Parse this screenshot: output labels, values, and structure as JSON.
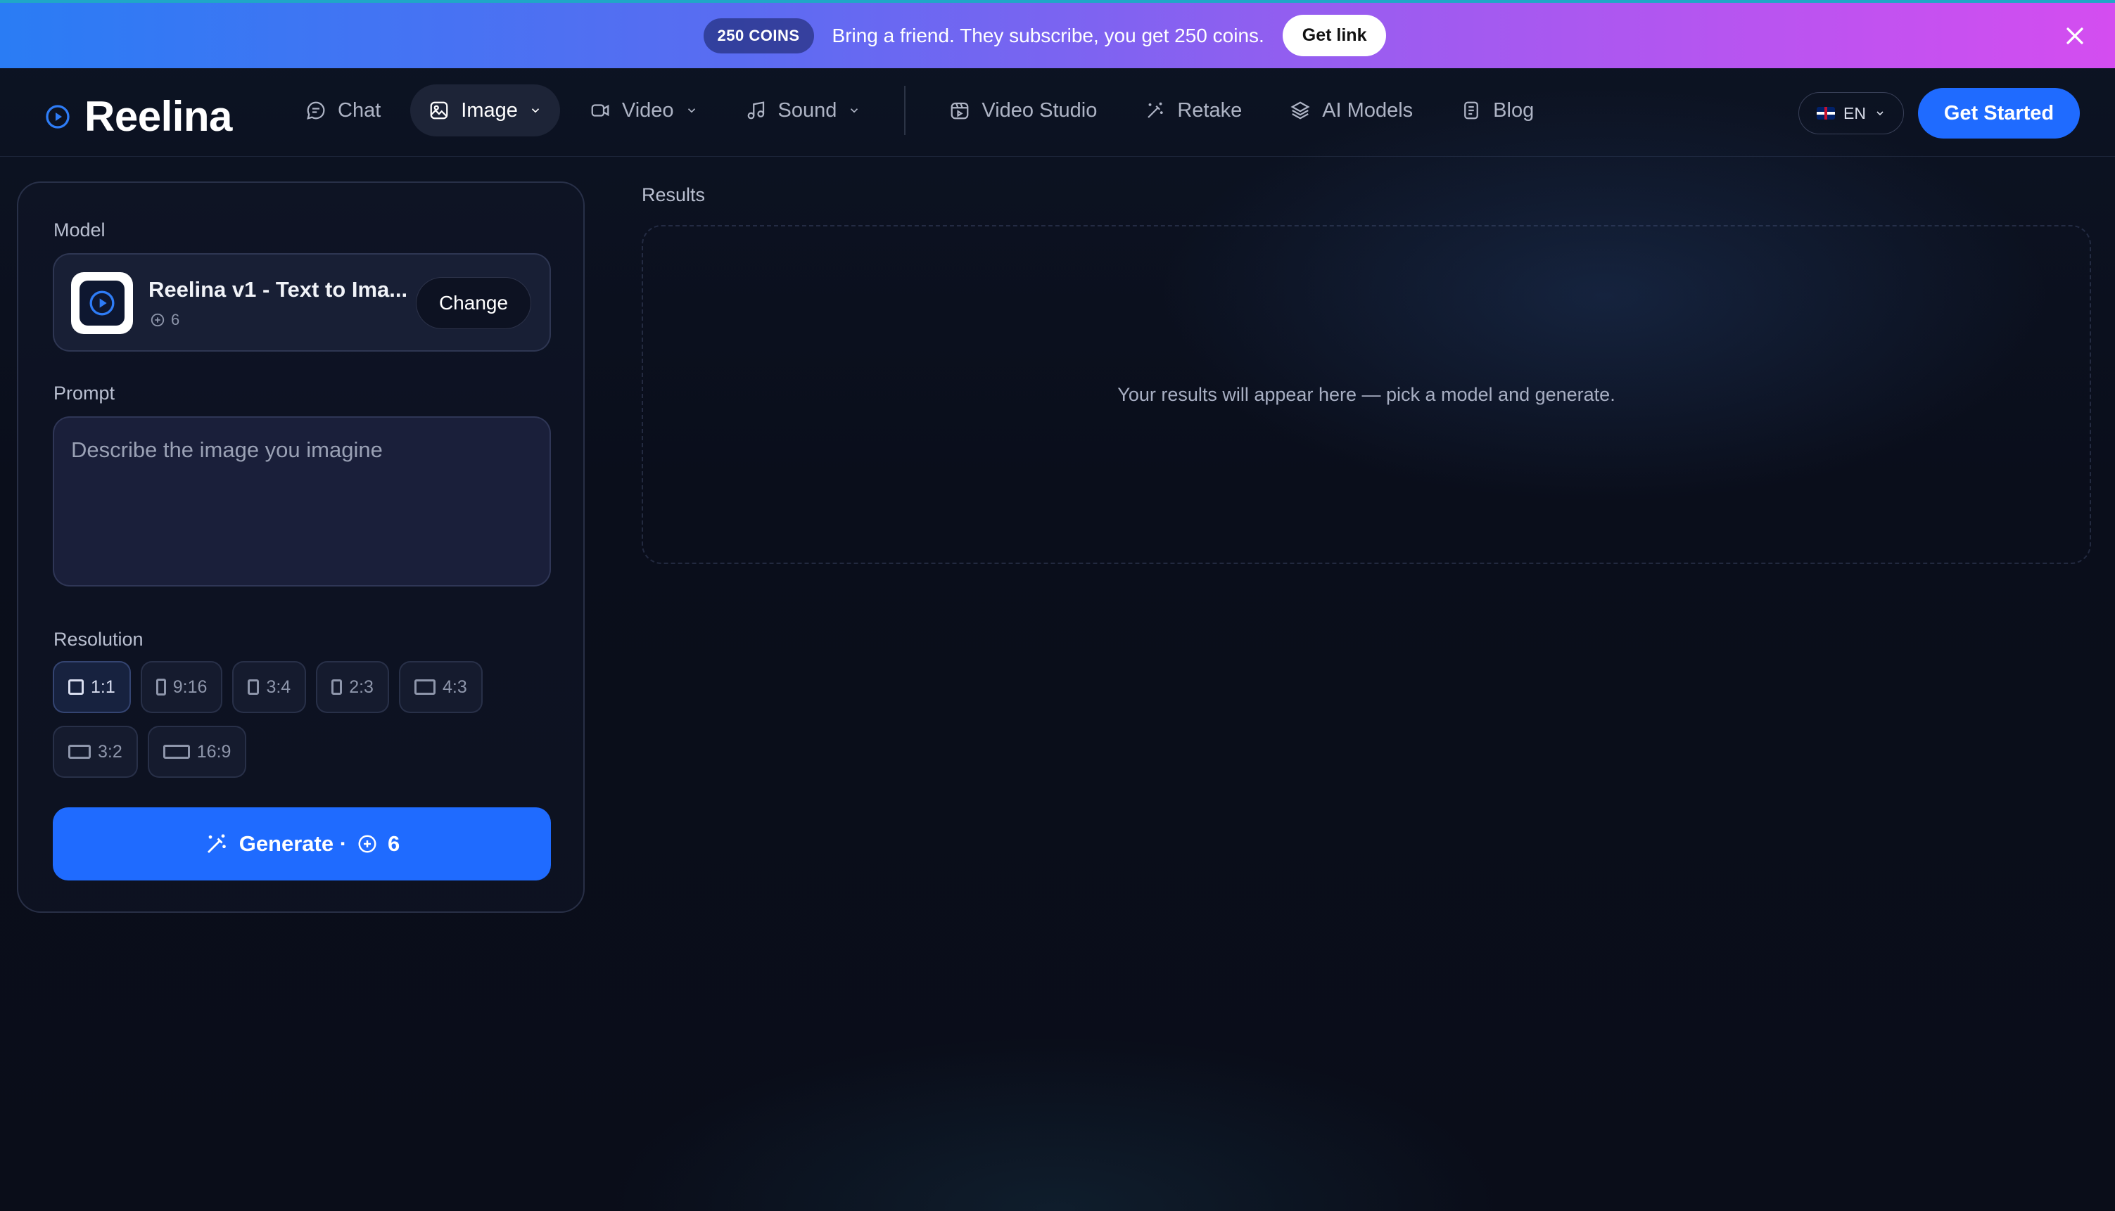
{
  "promo": {
    "badge": "250 COINS",
    "text": "Bring a friend. They subscribe, you get 250 coins.",
    "cta": "Get link"
  },
  "brand": {
    "name": "Reelina"
  },
  "nav": {
    "chat": "Chat",
    "image": "Image",
    "video": "Video",
    "sound": "Sound",
    "video_studio": "Video Studio",
    "retake": "Retake",
    "ai_models": "AI Models",
    "blog": "Blog"
  },
  "header": {
    "language": "EN",
    "get_started": "Get Started"
  },
  "panel": {
    "model_label": "Model",
    "model_name": "Reelina v1 - Text to Ima...",
    "model_cost": "6",
    "change": "Change",
    "prompt_label": "Prompt",
    "prompt_placeholder": "Describe the image you imagine",
    "prompt_value": "",
    "resolution_label": "Resolution",
    "resolutions": [
      "1:1",
      "9:16",
      "3:4",
      "2:3",
      "4:3",
      "3:2",
      "16:9"
    ],
    "selected_resolution": "1:1",
    "generate_label": "Generate ·",
    "generate_cost": "6"
  },
  "results": {
    "title": "Results",
    "empty_text": "Your results will appear here — pick a model and generate."
  },
  "colors": {
    "accent": "#1f6bff",
    "background": "#0a0e1b",
    "banner_start": "#2a7cf4",
    "banner_end": "#d44df0"
  },
  "icons": {
    "close": "close-icon",
    "chat": "chat-bubble-icon",
    "image": "image-icon",
    "video": "video-camera-icon",
    "sound": "music-note-icon",
    "video_studio": "studio-calendar-icon",
    "retake": "magic-wand-icon",
    "ai_models": "layers-icon",
    "blog": "document-icon",
    "coin": "coin-icon"
  }
}
